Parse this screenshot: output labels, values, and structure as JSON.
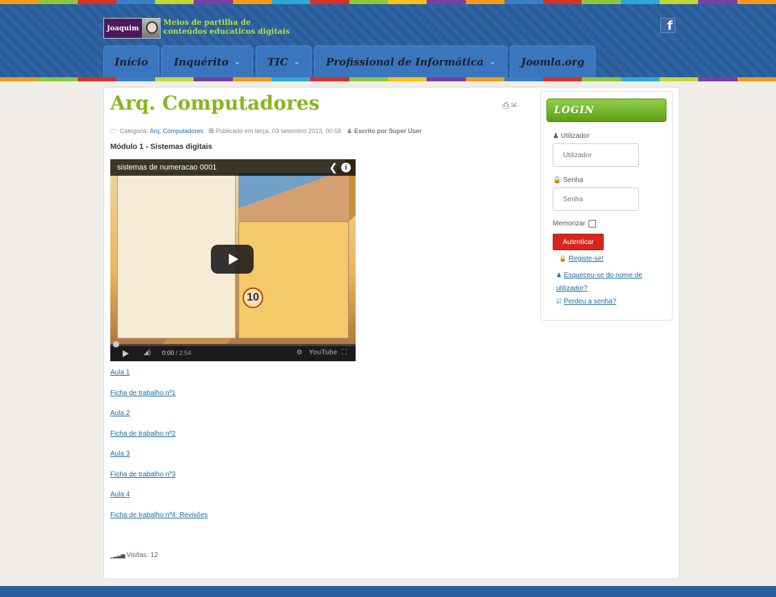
{
  "header": {
    "brand_name": "Joaquim",
    "tagline_line1": "Meios de partilha de",
    "tagline_line2": "conteúdos educaticos digitais",
    "facebook_icon": "facebook-icon",
    "stripe_colors": [
      "#f39a1c",
      "#8cc63f",
      "#d6322a",
      "#3b7fc4",
      "#c2d635",
      "#7b3fa0",
      "#f39a1c",
      "#2fa8d8",
      "#d6322a",
      "#8cc63f",
      "#f6c21b",
      "#7b3fa0",
      "#f39a1c",
      "#3b7fc4",
      "#d6322a",
      "#8cc63f",
      "#2fa8d8",
      "#c2d635",
      "#7b3fa0",
      "#f39a1c"
    ]
  },
  "nav": {
    "items": [
      {
        "label": "Início"
      },
      {
        "label": "Inquérito",
        "chevron": "chevron-down-icon"
      },
      {
        "label": "TIC",
        "chevron": "chevron-down-icon"
      },
      {
        "label": "Profissional de Informática",
        "chevron": "chevron-down-icon"
      },
      {
        "label": "Joomla.org"
      }
    ]
  },
  "article": {
    "title": "Arq. Computadores",
    "meta_category_label": "Categoria:",
    "meta_category_link": "Arq. Computadores",
    "meta_published": "Publicado em terça, 03 setembro 2013, 00:58",
    "meta_author": "Escrito por Super User",
    "module_label": "Módulo 1",
    "module_title": " - Sistemas digitais",
    "links": [
      "Aula 1",
      "Ficha de trabalho nº1",
      "Aula 2",
      "Ficha de trabalho nº2",
      "Aula 3",
      "Ficha de trabalho nº3",
      "Aula 4",
      "Ficha de trabalho nº4_Revisões"
    ],
    "hits": "Visitas: 12"
  },
  "video": {
    "title": "sistemas de numeracao 0001",
    "time_current": "0:00",
    "time_total": " / 2:54",
    "overlay_number": "10",
    "brand": "YouTube",
    "progress": 0
  },
  "login": {
    "title": "LOGIN",
    "username_label": "Utilizador",
    "username_placeholder": "Utilizador",
    "password_label": "Senha",
    "password_placeholder": "Senha",
    "remember_label": "Memorizar",
    "submit_label": "Autenticar",
    "register_link": "Registe-se!",
    "forgot_user_line1": "Esqueceu-se do nome de",
    "forgot_user_line2": "utilizador?",
    "forgot_password_link": "Perdeu a senha?"
  }
}
